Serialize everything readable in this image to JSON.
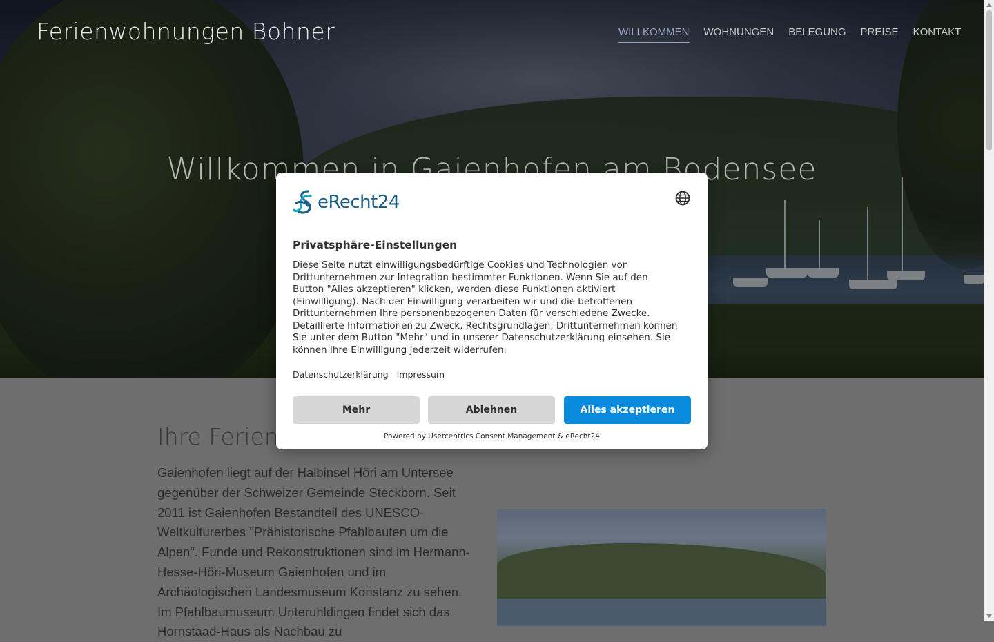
{
  "site": {
    "logo": "Ferienwohnungen Bohner",
    "nav": [
      {
        "label": "WILLKOMMEN",
        "active": true
      },
      {
        "label": "WOHNUNGEN",
        "active": false
      },
      {
        "label": "BELEGUNG",
        "active": false
      },
      {
        "label": "PREISE",
        "active": false
      },
      {
        "label": "KONTAKT",
        "active": false
      }
    ],
    "hero_title": "Willkommen in Gaienhofen am Bodensee"
  },
  "content": {
    "section_title": "Ihre Ferien am Bodensee",
    "paragraph": "Gaienhofen liegt auf der Halbinsel Höri am Untersee gegenüber der Schweizer Gemeinde Steckborn. Seit 2011 ist Gaienhofen Bestandteil des UNESCO-Weltkulturerbes \"Prähistorische Pfahlbauten um die Alpen\". Funde und Rekonstruktionen sind im Hermann-Hesse-Höri-Museum Gaienhofen und im Archäologischen Landesmuseum Konstanz zu sehen. Im Pfahlbaumuseum Unteruhldingen findet sich das Hornstaad-Haus als Nachbau zu"
  },
  "consent": {
    "brand_name": "eRecht24",
    "title": "Privatsphäre-Einstellungen",
    "text": "Diese Seite nutzt einwilligungsbedürftige Cookies und Technologien von Drittunternehmen zur Integration bestimmter Funktionen. Wenn Sie auf den Button \"Alles akzeptieren\" klicken, werden diese Funktionen aktiviert (Einwilligung). Nach der Einwilligung verarbeiten wir und die betroffenen Drittunternehmen Ihre personenbezogenen Daten für verschiedene Zwecke. Detaillierte Informationen zu Zweck, Rechtsgrundlagen, Drittunternehmen können Sie unter dem Button \"Mehr\" und in unserer Datenschutzerklärung einsehen. Sie können Ihre Einwilligung jederzeit widerrufen.",
    "link_privacy": "Datenschutzerklärung",
    "link_imprint": "Impressum",
    "btn_more": "Mehr",
    "btn_decline": "Ablehnen",
    "btn_accept": "Alles akzeptieren",
    "powered_by": "Powered by Usercentrics Consent Management & eRecht24",
    "accent_color": "#0b8bde",
    "brand_color": "#1b5f86"
  }
}
